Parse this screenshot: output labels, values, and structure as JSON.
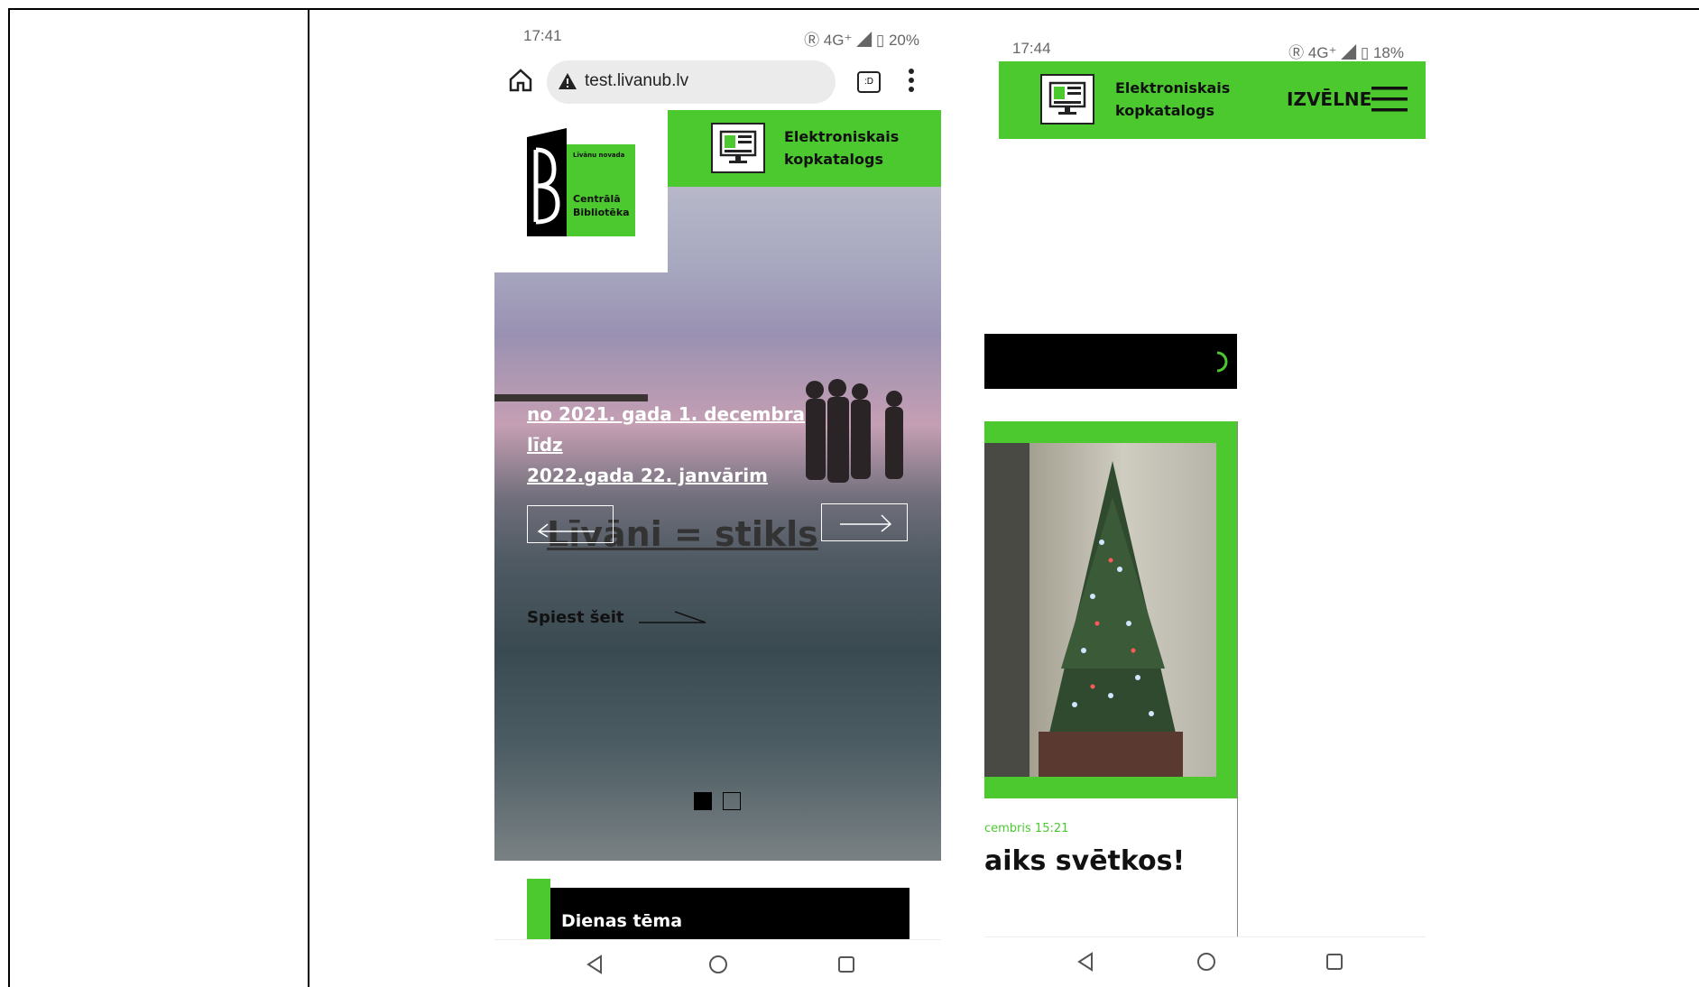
{
  "phone1": {
    "status": {
      "time": "17:41",
      "right": "Ⓡ 4G⁺ ◢ ▯ 20%"
    },
    "url": "test.livanub.lv",
    "tabs_label": ":D",
    "logo": {
      "line1": "Līvānu novada",
      "line2": "Centrālā",
      "line3": "Bibliotēka"
    },
    "catalog": {
      "line1": "Elektroniskais",
      "line2": "kopkatalogs"
    },
    "slide": {
      "date_line1": "no 2021. gada 1. decembra",
      "date_line2": "līdz",
      "date_line3": "2022.gada 22. janvārim",
      "title": "Līvāni = stikls",
      "cta": "Spiest šeit"
    },
    "section_label": "Dienas tēma"
  },
  "phone2": {
    "status": {
      "time": "17:44",
      "right": "Ⓡ 4G⁺ ◢ ▯ 18%"
    },
    "catalog": {
      "line1": "Elektroniskais",
      "line2": "kopkatalogs"
    },
    "menu_label": "IZVĒLNE",
    "card": {
      "date": "cembris 15:21",
      "title": "aiks svētkos!"
    }
  },
  "colors": {
    "accent": "#4bc92f",
    "dark": "#000000"
  }
}
